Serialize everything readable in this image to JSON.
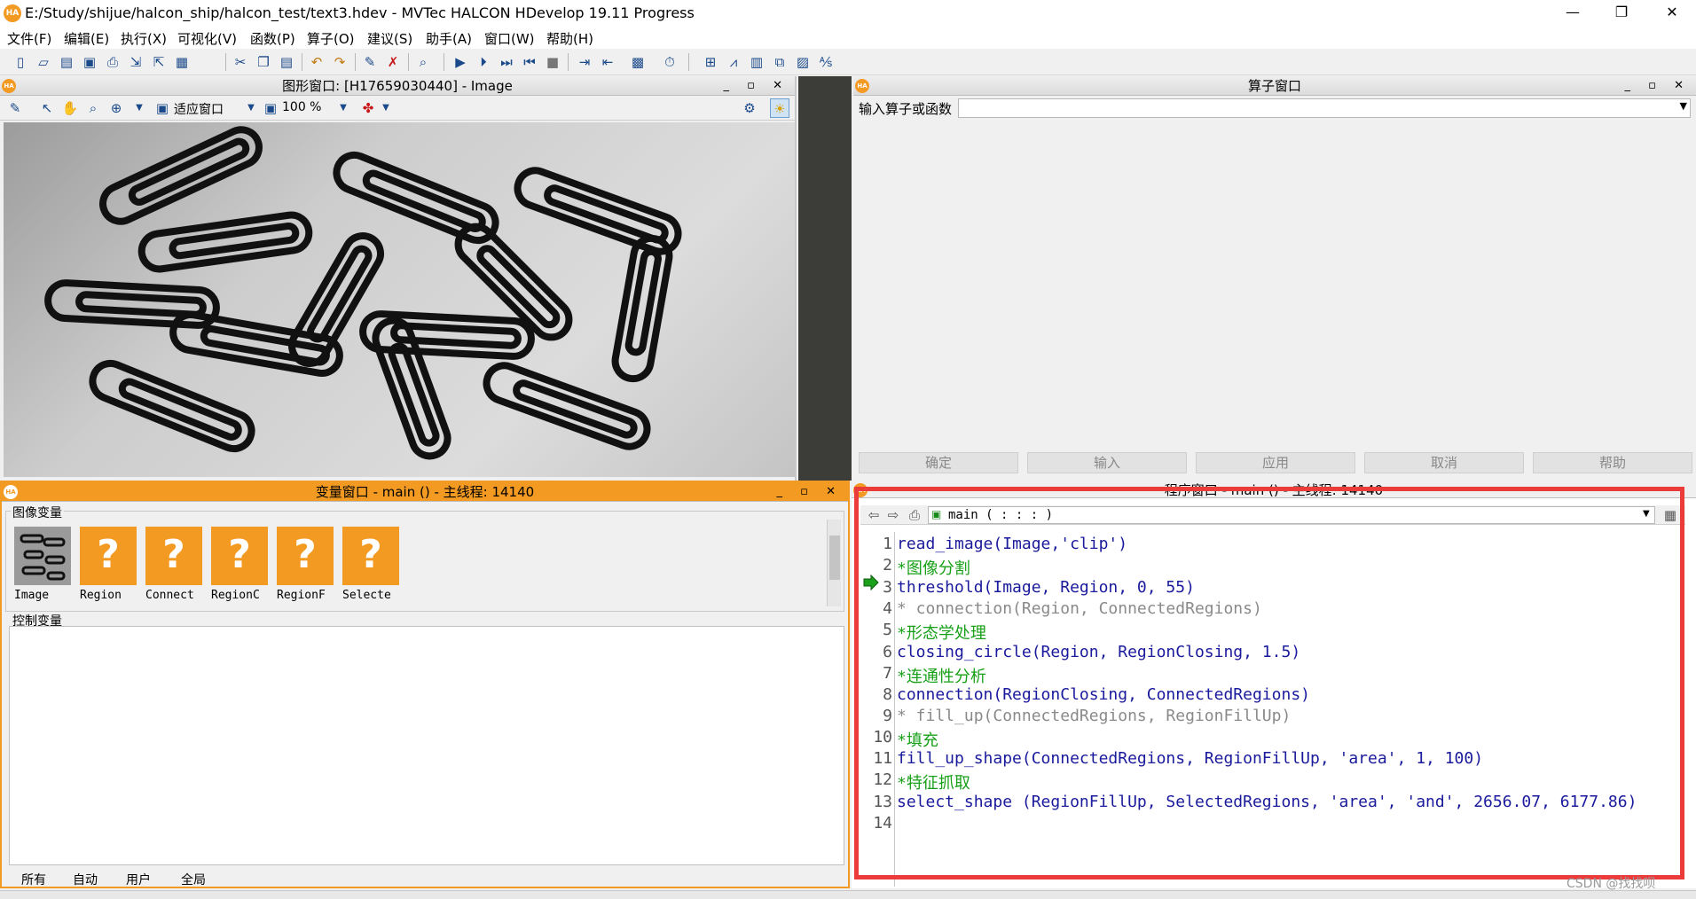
{
  "window": {
    "title": "E:/Study/shijue/halcon_ship/halcon_test/text3.hdev - MVTec HALCON HDevelop 19.11 Progress",
    "app_icon": "HA",
    "minimize": "—",
    "maximize": "❐",
    "close": "✕"
  },
  "menu": [
    "文件(F)",
    "编辑(E)",
    "执行(X)",
    "可视化(V)",
    "函数(P)",
    "算子(O)",
    "建议(S)",
    "助手(A)",
    "窗口(W)",
    "帮助(H)"
  ],
  "graphics_window": {
    "title": "图形窗口: [H17659030440] - Image",
    "fit_label": "适应窗口",
    "zoom_label": "100 %"
  },
  "operator_window": {
    "title": "算子窗口",
    "input_label": "输入算子或函数",
    "input_value": "",
    "buttons": [
      "确定",
      "输入",
      "应用",
      "取消",
      "帮助"
    ]
  },
  "variable_window": {
    "title": "变量窗口 - main () - 主线程: 14140",
    "image_vars_label": "图像变量",
    "control_vars_label": "控制变量",
    "image_vars": [
      "Image",
      "Region",
      "Connect",
      "RegionC",
      "RegionF",
      "Selecte"
    ],
    "unknown_glyph": "?",
    "tabs": [
      "所有",
      "自动",
      "用户",
      "全局"
    ]
  },
  "program_window": {
    "title": "程序窗口 - main () - 主线程: 14140",
    "procedure": "main ( : : : )",
    "lines": [
      {
        "no": "1",
        "text": "read_image(Image,'clip')",
        "color": "#1a1a9c"
      },
      {
        "no": "2",
        "text": "*图像分割",
        "color": "#18a018"
      },
      {
        "no": "3",
        "text": "threshold(Image, Region, 0, 55)",
        "color": "#1a1a9c"
      },
      {
        "no": "4",
        "text": "* connection(Region, ConnectedRegions)",
        "color": "#8a8a8a"
      },
      {
        "no": "5",
        "text": "*形态学处理",
        "color": "#18a018"
      },
      {
        "no": "6",
        "text": "closing_circle(Region, RegionClosing, 1.5)",
        "color": "#1a1a9c"
      },
      {
        "no": "7",
        "text": "*连通性分析",
        "color": "#18a018"
      },
      {
        "no": "8",
        "text": "connection(RegionClosing, ConnectedRegions)",
        "color": "#1a1a9c"
      },
      {
        "no": "9",
        "text": "* fill_up(ConnectedRegions, RegionFillUp)",
        "color": "#8a8a8a"
      },
      {
        "no": "10",
        "text": "*填充",
        "color": "#18a018"
      },
      {
        "no": "11",
        "text": "fill_up_shape(ConnectedRegions, RegionFillUp, 'area', 1, 100)",
        "color": "#1a1a9c"
      },
      {
        "no": "12",
        "text": "*特征抓取",
        "color": "#18a018"
      },
      {
        "no": "13",
        "text": "select_shape (RegionFillUp, SelectedRegions, 'area', 'and', 2656.07, 6177.86)",
        "color": "#1a1a9c"
      },
      {
        "no": "14",
        "text": "",
        "color": "#1a1a9c"
      }
    ]
  },
  "watermark": "CSDN @找找呗",
  "colors": {
    "accent": "#f39a22",
    "highlight": "#ec3b3b"
  }
}
